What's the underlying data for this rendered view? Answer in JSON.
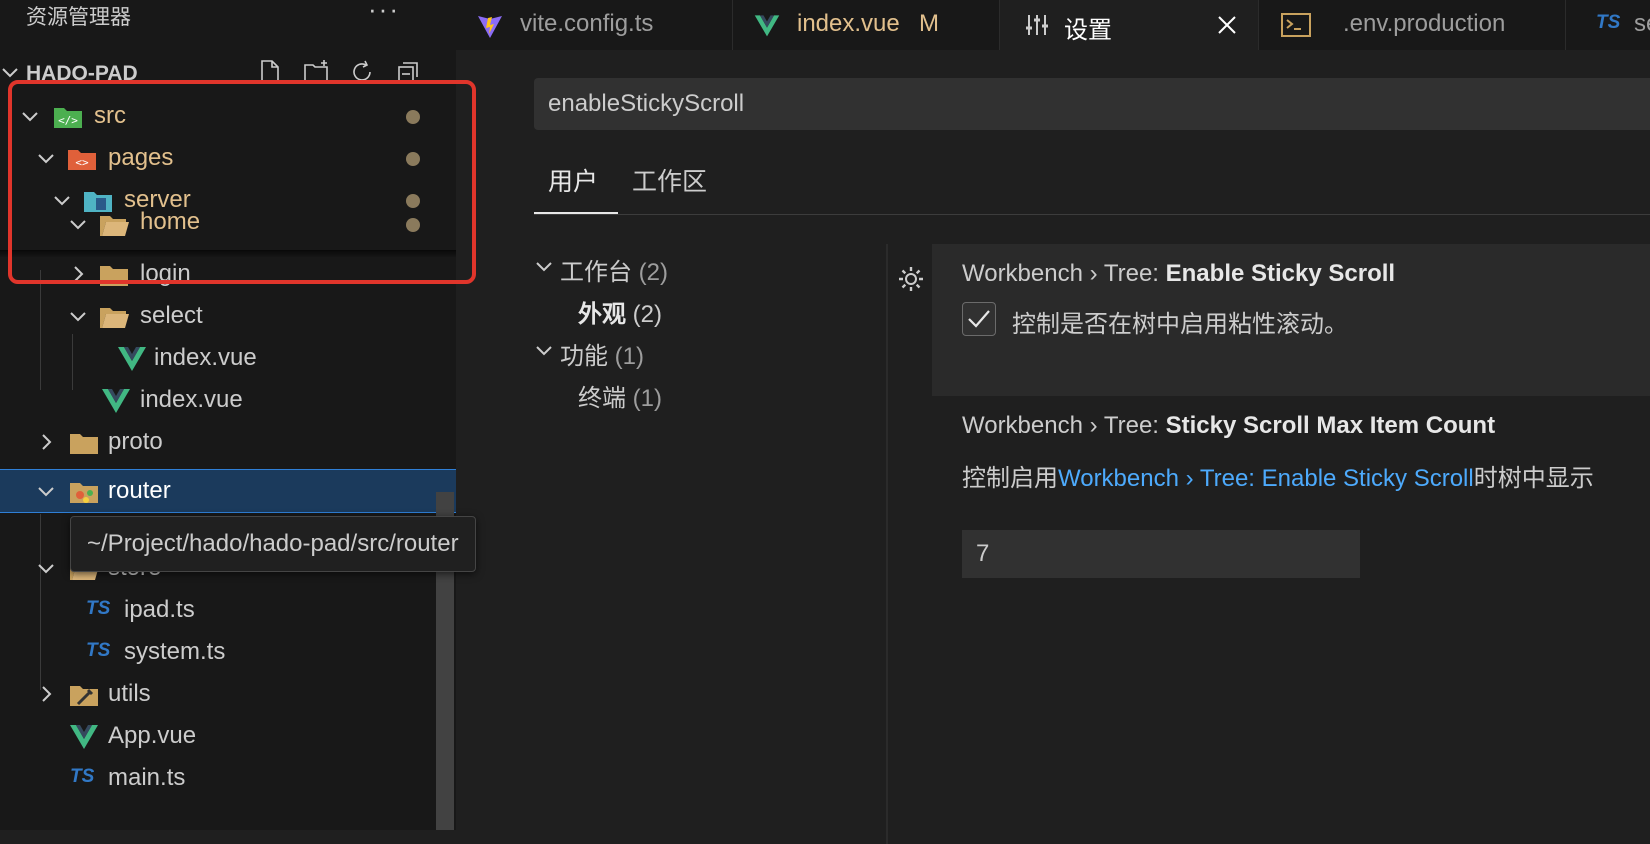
{
  "explorer": {
    "title": "资源管理器",
    "more": "···",
    "project": "HADO-PAD",
    "tooltip": "~/Project/hado/hado-pad/src/router",
    "items": [
      {
        "name": "src",
        "type": "folder",
        "expanded": true
      },
      {
        "name": "pages",
        "type": "folder",
        "expanded": true
      },
      {
        "name": "server",
        "type": "folder",
        "expanded": true
      },
      {
        "name": "home",
        "type": "folder",
        "expanded": true
      },
      {
        "name": "login",
        "type": "folder",
        "expanded": false
      },
      {
        "name": "select",
        "type": "folder",
        "expanded": true
      },
      {
        "name": "index.vue",
        "type": "vue"
      },
      {
        "name": "index.vue",
        "type": "vue"
      },
      {
        "name": "proto",
        "type": "folder",
        "expanded": false
      },
      {
        "name": "router",
        "type": "folder",
        "expanded": true,
        "selected": true
      },
      {
        "name": "store",
        "type": "folder",
        "expanded": true
      },
      {
        "name": "ipad.ts",
        "type": "ts"
      },
      {
        "name": "system.ts",
        "type": "ts"
      },
      {
        "name": "utils",
        "type": "folder",
        "expanded": false
      },
      {
        "name": "App.vue",
        "type": "vue"
      },
      {
        "name": "main.ts",
        "type": "ts"
      }
    ]
  },
  "tabs": [
    {
      "label": "vite.config.ts",
      "icon": "vite-icon"
    },
    {
      "label": "index.vue",
      "badge": "M",
      "icon": "vue-icon"
    },
    {
      "label": "设置",
      "icon": "settings-sliders-icon",
      "active": true
    },
    {
      "label": ".env.production",
      "icon": "terminal-icon"
    },
    {
      "label": "ser",
      "icon": "ts-icon"
    }
  ],
  "settings": {
    "search": "enableStickyScroll",
    "scopes": [
      "用户",
      "工作区"
    ],
    "toc": [
      {
        "label": "工作台",
        "count": "(2)"
      },
      {
        "label": "外观",
        "count": "(2)"
      },
      {
        "label": "功能",
        "count": "(1)"
      },
      {
        "label": "终端",
        "count": "(1)"
      }
    ],
    "setting1": {
      "prefix": "Workbench › Tree: ",
      "name": "Enable Sticky Scroll",
      "desc": "控制是否在树中启用粘性滚动。",
      "checked": true
    },
    "setting2": {
      "prefix": "Workbench › Tree: ",
      "name": "Sticky Scroll Max Item Count",
      "desc_before": "控制启用",
      "desc_link": "Workbench › Tree: Enable Sticky Scroll",
      "desc_after": "时树中显示",
      "value": "7"
    }
  },
  "colors": {
    "accent": "#2f7fd6",
    "highlight": "#e0352b",
    "modified": "#e2c08d",
    "link": "#4daafc"
  }
}
